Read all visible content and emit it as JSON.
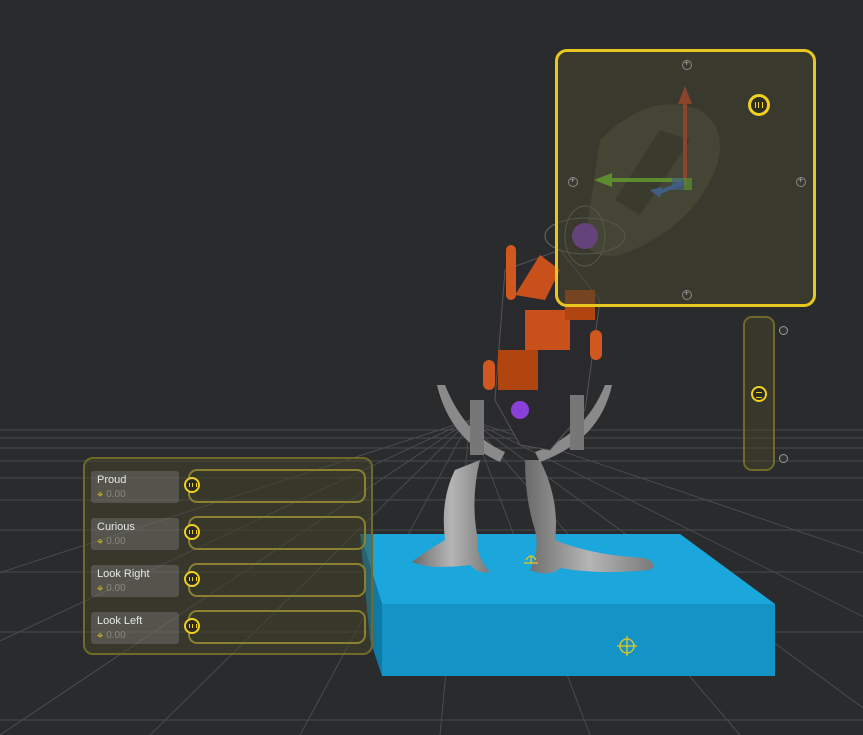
{
  "viewport": {
    "background": "#2a2b2d",
    "grid_color": "#4a4b4e",
    "base_color": "#1aa7dc"
  },
  "blendshapes": [
    {
      "name": "Proud",
      "value": "0.00"
    },
    {
      "name": "Curious",
      "value": "0.00"
    },
    {
      "name": "Look Right",
      "value": "0.00"
    },
    {
      "name": "Look Left",
      "value": "0.00"
    }
  ],
  "colors": {
    "accent": "#f0d020",
    "gizmo_x": "#e0402a",
    "gizmo_y": "#7ee030",
    "gizmo_z": "#3a7ae8",
    "joint": "#8a40d8",
    "robot_parts": "#c8501a"
  }
}
